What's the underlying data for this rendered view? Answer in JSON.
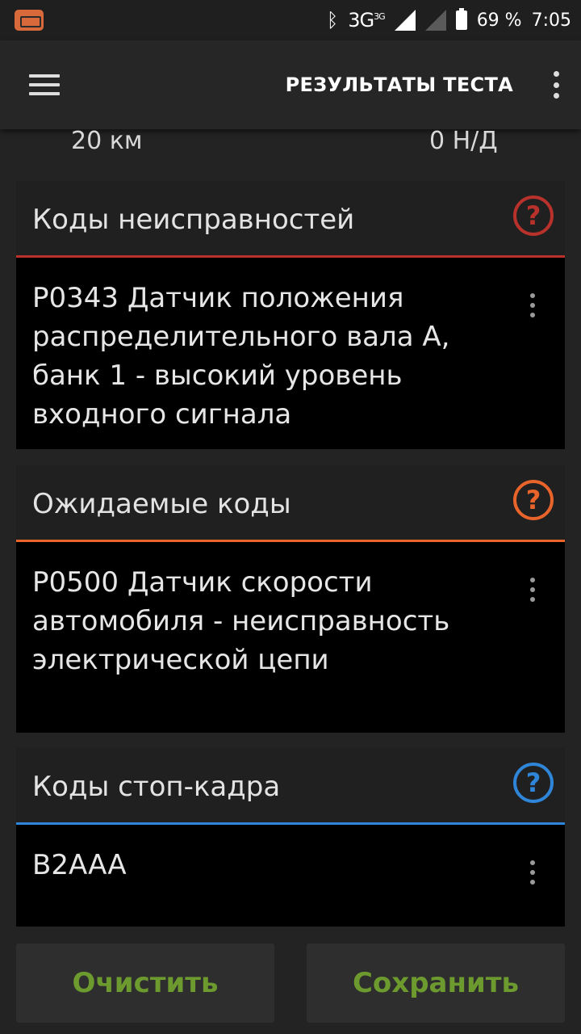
{
  "status_bar": {
    "network": "3G",
    "network_sup": "3G",
    "battery": "69 %",
    "time": "7:05"
  },
  "toolbar": {
    "title": "РЕЗУЛЬТАТЫ ТЕСТА"
  },
  "stats": {
    "left": "20 км",
    "right": "0 Н/Д"
  },
  "sections": [
    {
      "title": "Коды неисправностей",
      "accent": "#b8312a",
      "text": "P0343 Датчик положения распределительного вала A, банк 1 - высокий уровень входного сигнала"
    },
    {
      "title": "Ожидаемые коды",
      "accent": "#e8642a",
      "text": "P0500 Датчик скорости автомобиля - неисправность электрической цепи"
    },
    {
      "title": "Коды стоп-кадра",
      "accent": "#2f86d8",
      "text": "B2AAA"
    }
  ],
  "buttons": {
    "clear": "Очистить",
    "save": "Сохранить",
    "color": "#6d9a2e"
  },
  "icons": {
    "help": "?",
    "bluetooth": "ᛒ"
  }
}
